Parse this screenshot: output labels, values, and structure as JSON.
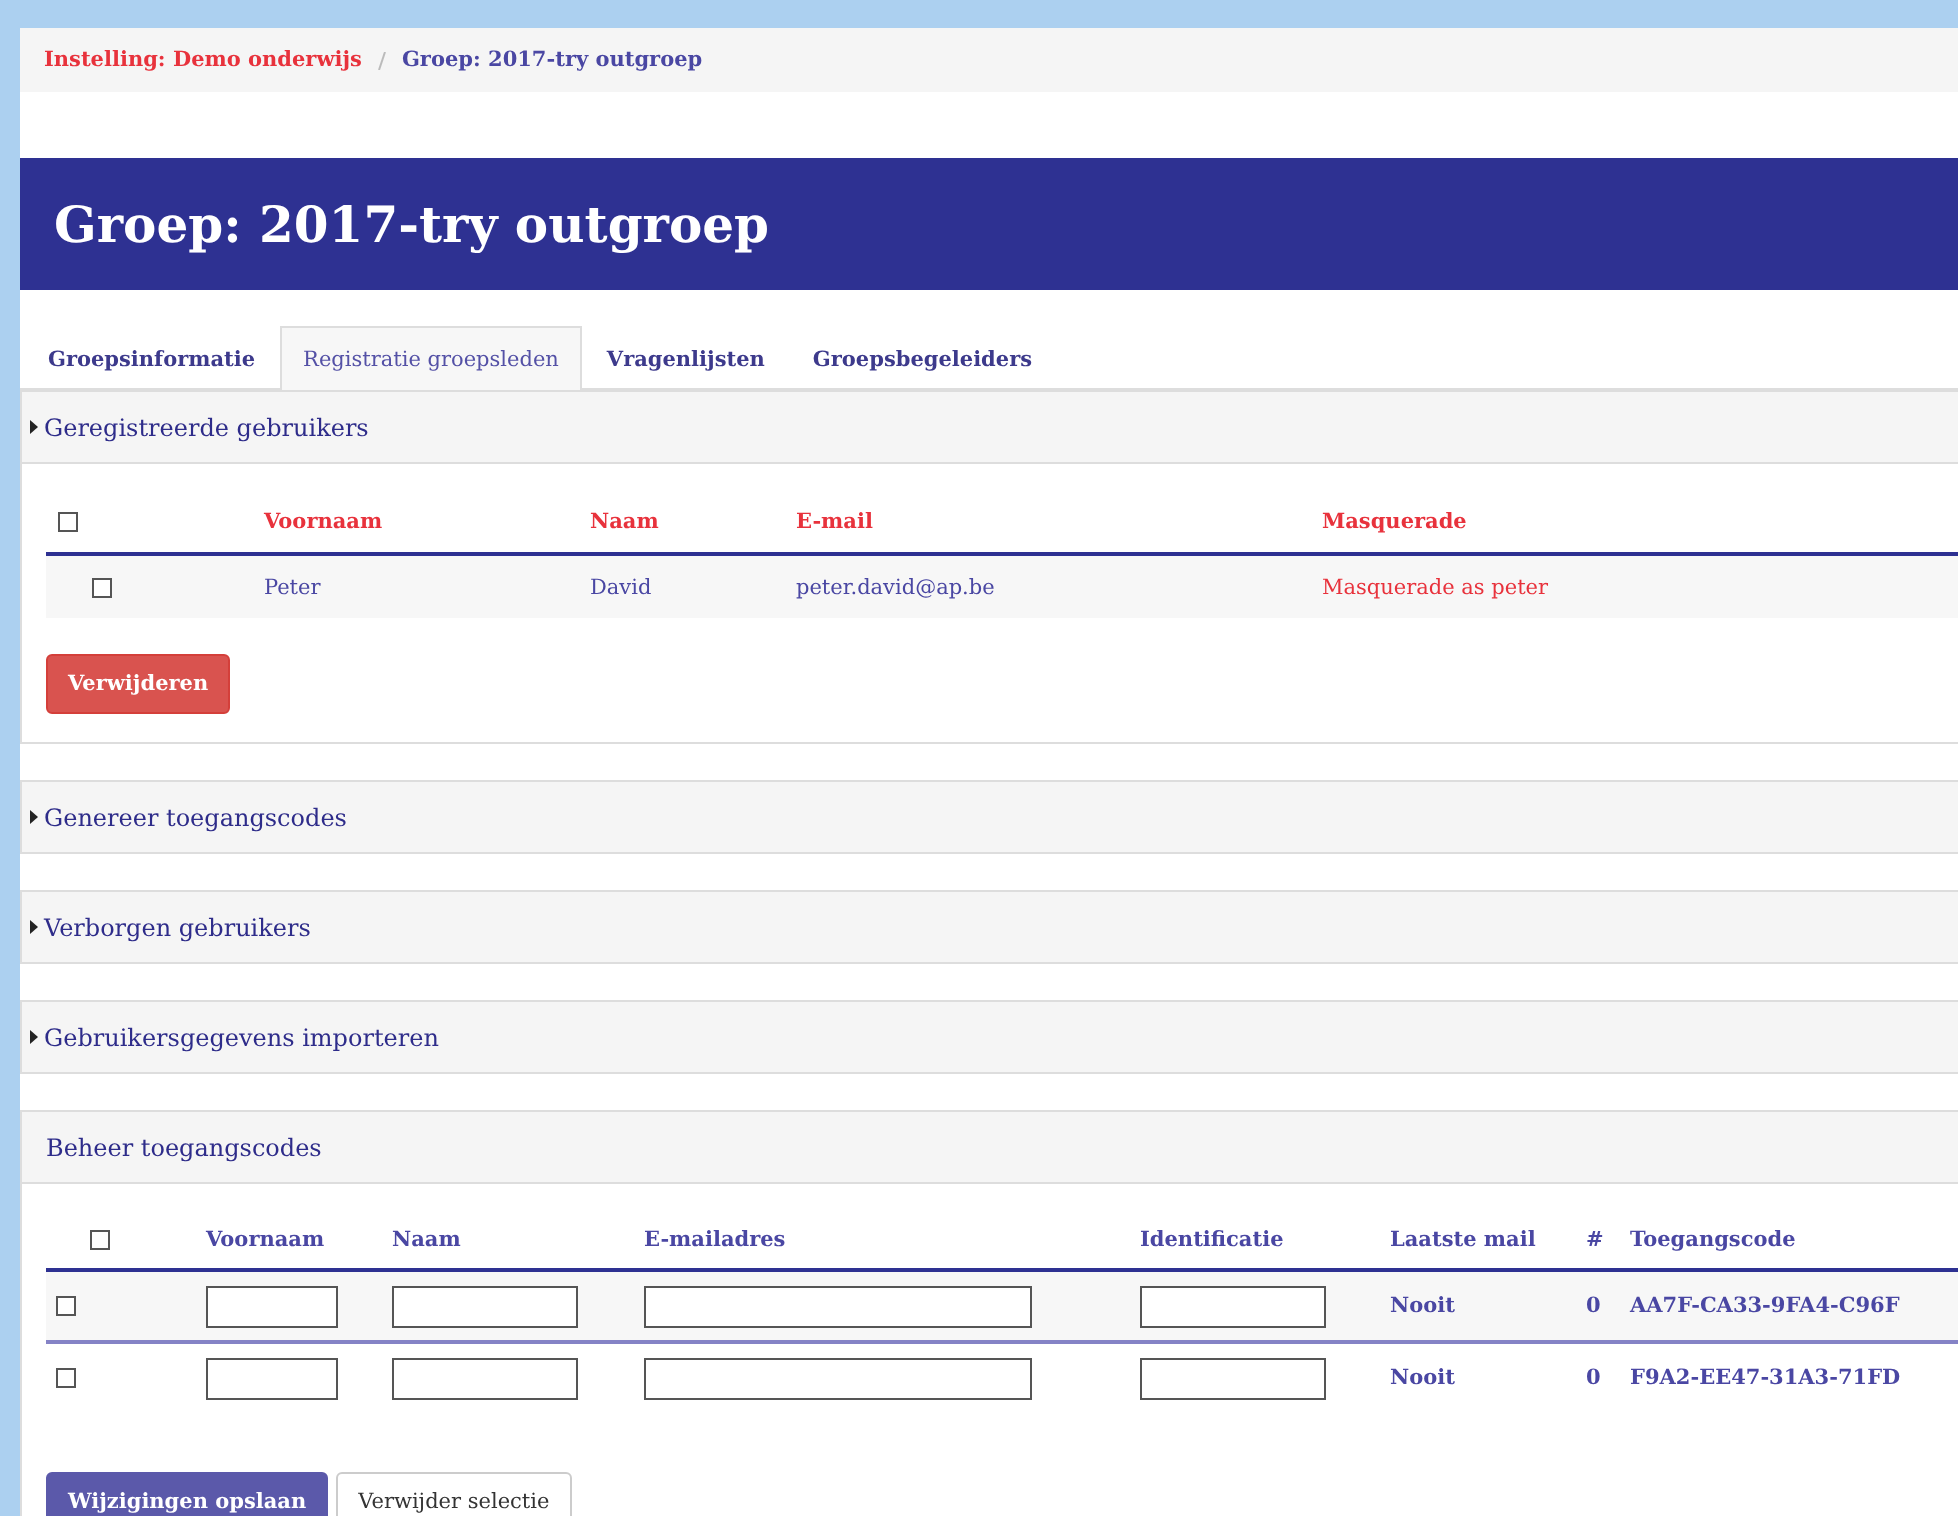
{
  "breadcrumb": [
    {
      "label": "Instelling: Demo onderwijs",
      "current": false
    },
    {
      "label": "Groep: 2017-try outgroep",
      "current": true
    }
  ],
  "title": "Groep: 2017-try outgroep",
  "tabs": [
    {
      "label": "Groepsinformatie",
      "selected": false
    },
    {
      "label": "Registratie groepsleden",
      "selected": true
    },
    {
      "label": "Vragenlijsten",
      "selected": false
    },
    {
      "label": "Groepsbegeleiders",
      "selected": false
    }
  ],
  "panels": [
    {
      "kind": "users",
      "title": "Geregistreerde gebruikers",
      "collapsible": true,
      "expanded": true,
      "select_all": {
        "checked": false
      },
      "columns": [
        "Voornaam",
        "Naam",
        "E-mail",
        "Masquerade"
      ],
      "rows": [
        {
          "checked": false,
          "cells": [
            "Peter",
            "David",
            "peter.david@ap.be",
            "Masquerade as peter"
          ]
        }
      ],
      "buttons": [
        {
          "label": "Verwijderen",
          "kind": "danger"
        }
      ]
    },
    {
      "title": "Genereer toegangscodes",
      "collapsible": true,
      "expanded": false
    },
    {
      "title": "Verborgen gebruikers",
      "collapsible": true,
      "expanded": false
    },
    {
      "title": "Gebruikersgegevens importeren",
      "collapsible": true,
      "expanded": false
    },
    {
      "kind": "codes",
      "title": "Beheer toegangscodes",
      "collapsible": false,
      "expanded": true,
      "select_all": {
        "checked": false
      },
      "columns": [
        "Voornaam",
        "Naam",
        "E-mailadres",
        "Identificatie",
        "Laatste mail",
        "#",
        "Toegangscode"
      ],
      "rows": [
        {
          "checked": false,
          "last_mail": "Nooit",
          "count": "0",
          "code": "AA7F-CA33-9FA4-C96F"
        },
        {
          "checked": false,
          "last_mail": "Nooit",
          "count": "0",
          "code": "F9A2-EE47-31A3-71FD"
        }
      ],
      "buttons": [
        {
          "label": "Wijzigingen opslaan",
          "kind": "primary"
        },
        {
          "label": "Verwijder selectie",
          "kind": "default"
        }
      ]
    }
  ]
}
